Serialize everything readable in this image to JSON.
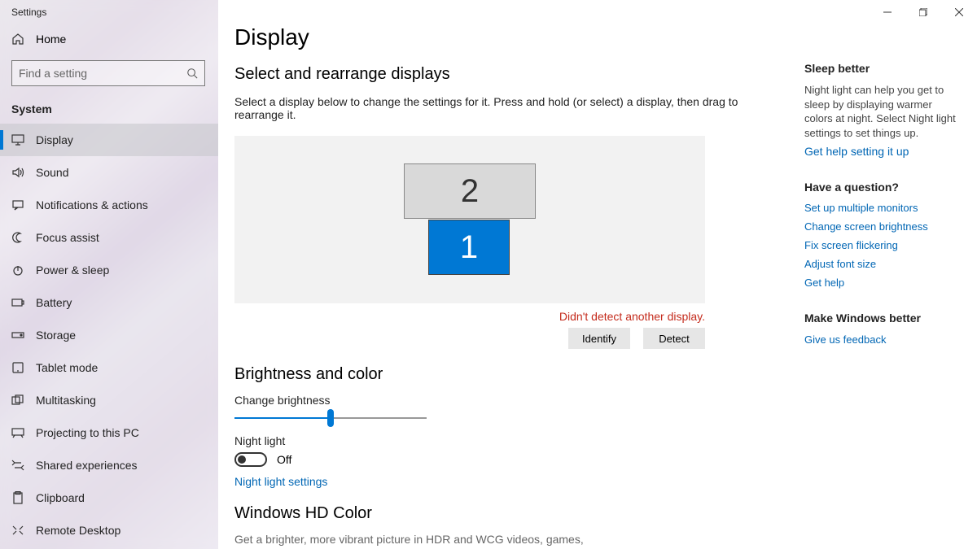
{
  "window": {
    "title": "Settings"
  },
  "sidebar": {
    "home": "Home",
    "search_placeholder": "Find a setting",
    "section": "System",
    "items": [
      {
        "label": "Display"
      },
      {
        "label": "Sound"
      },
      {
        "label": "Notifications & actions"
      },
      {
        "label": "Focus assist"
      },
      {
        "label": "Power & sleep"
      },
      {
        "label": "Battery"
      },
      {
        "label": "Storage"
      },
      {
        "label": "Tablet mode"
      },
      {
        "label": "Multitasking"
      },
      {
        "label": "Projecting to this PC"
      },
      {
        "label": "Shared experiences"
      },
      {
        "label": "Clipboard"
      },
      {
        "label": "Remote Desktop"
      }
    ]
  },
  "main": {
    "title": "Display",
    "arrange": {
      "heading": "Select and rearrange displays",
      "desc": "Select a display below to change the settings for it. Press and hold (or select) a display, then drag to rearrange it.",
      "monitor1": "1",
      "monitor2": "2",
      "warning": "Didn't detect another display.",
      "identify": "Identify",
      "detect": "Detect"
    },
    "brightness": {
      "heading": "Brightness and color",
      "change_label": "Change brightness",
      "night_label": "Night light",
      "toggle_state": "Off",
      "settings_link": "Night light settings"
    },
    "hd": {
      "heading": "Windows HD Color",
      "desc": "Get a brighter, more vibrant picture in HDR and WCG videos, games,"
    }
  },
  "right": {
    "sleep": {
      "heading": "Sleep better",
      "text": "Night light can help you get to sleep by displaying warmer colors at night. Select Night light settings to set things up.",
      "link": "Get help setting it up"
    },
    "question": {
      "heading": "Have a question?",
      "links": [
        "Set up multiple monitors",
        "Change screen brightness",
        "Fix screen flickering",
        "Adjust font size",
        "Get help"
      ]
    },
    "feedback": {
      "heading": "Make Windows better",
      "link": "Give us feedback"
    }
  }
}
